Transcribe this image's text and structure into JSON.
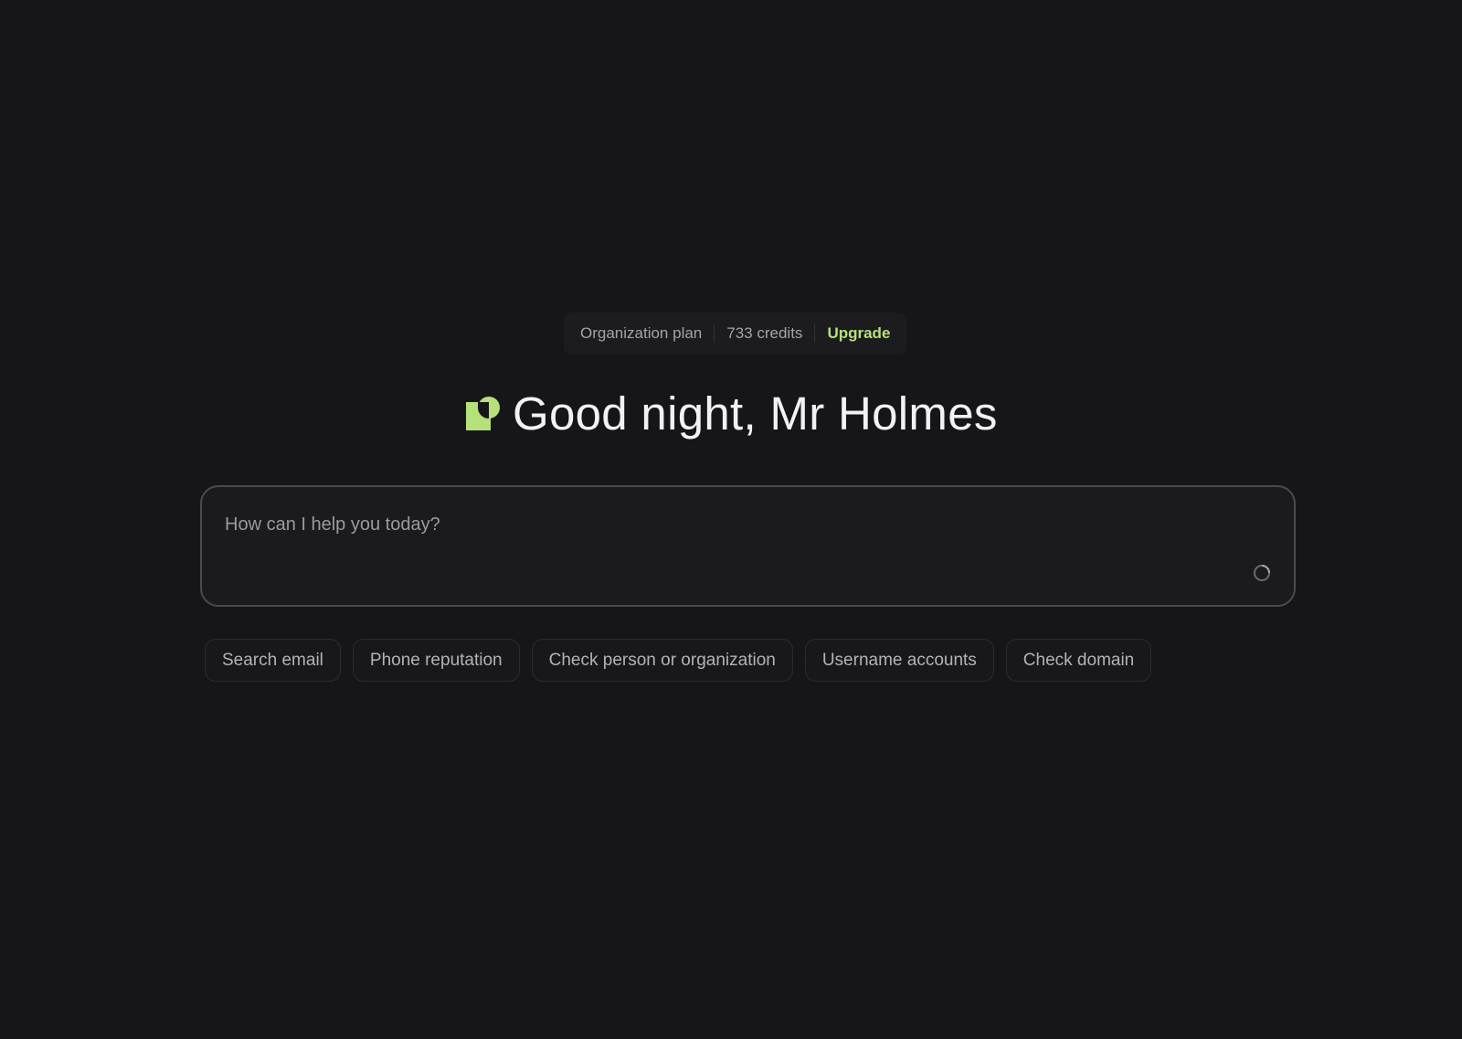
{
  "plan": {
    "plan_label": "Organization plan",
    "credits_label": "733 credits",
    "upgrade_label": "Upgrade"
  },
  "greeting": {
    "text": "Good night, Mr Holmes",
    "logo_icon": "brand-logo-icon"
  },
  "prompt": {
    "placeholder": "How can I help you today?",
    "value": "",
    "status_icon": "loading-spinner-icon"
  },
  "suggestions": [
    {
      "label": "Search email"
    },
    {
      "label": "Phone reputation"
    },
    {
      "label": "Check person or organization"
    },
    {
      "label": "Username accounts"
    },
    {
      "label": "Check domain"
    }
  ],
  "colors": {
    "background": "#161618",
    "accent": "#b5e07a",
    "text_primary": "#f2f2f4",
    "text_muted": "#a3a3a8"
  }
}
